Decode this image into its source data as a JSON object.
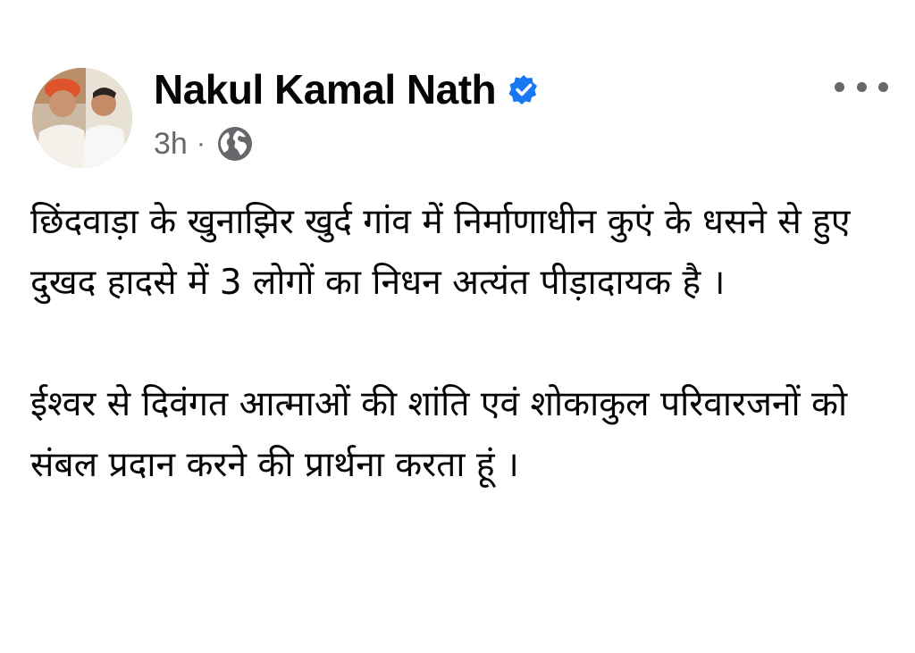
{
  "post": {
    "author_name": "Nakul Kamal Nath",
    "verified_icon": "verified-badge-icon",
    "timestamp": "3h",
    "separator": "·",
    "audience_icon": "globe-icon",
    "more_icon": "more-options-icon",
    "paragraphs": [
      "छिंदवाड़ा के खुनाझिर खुर्द गांव में निर्माणाधीन कुएं के धसने से हुए दुखद हादसे में 3 लोगों का निधन अत्यंत पीड़ादायक है ।",
      "ईश्वर से दिवंगत आत्माओं की शांति एवं शोकाकुल परिवारजनों को संबल प्रदान करने की प्रार्थना करता हूं ।"
    ]
  },
  "colors": {
    "name": "#050505",
    "meta": "#65676b",
    "verified": "#1877f2",
    "background": "#ffffff"
  }
}
